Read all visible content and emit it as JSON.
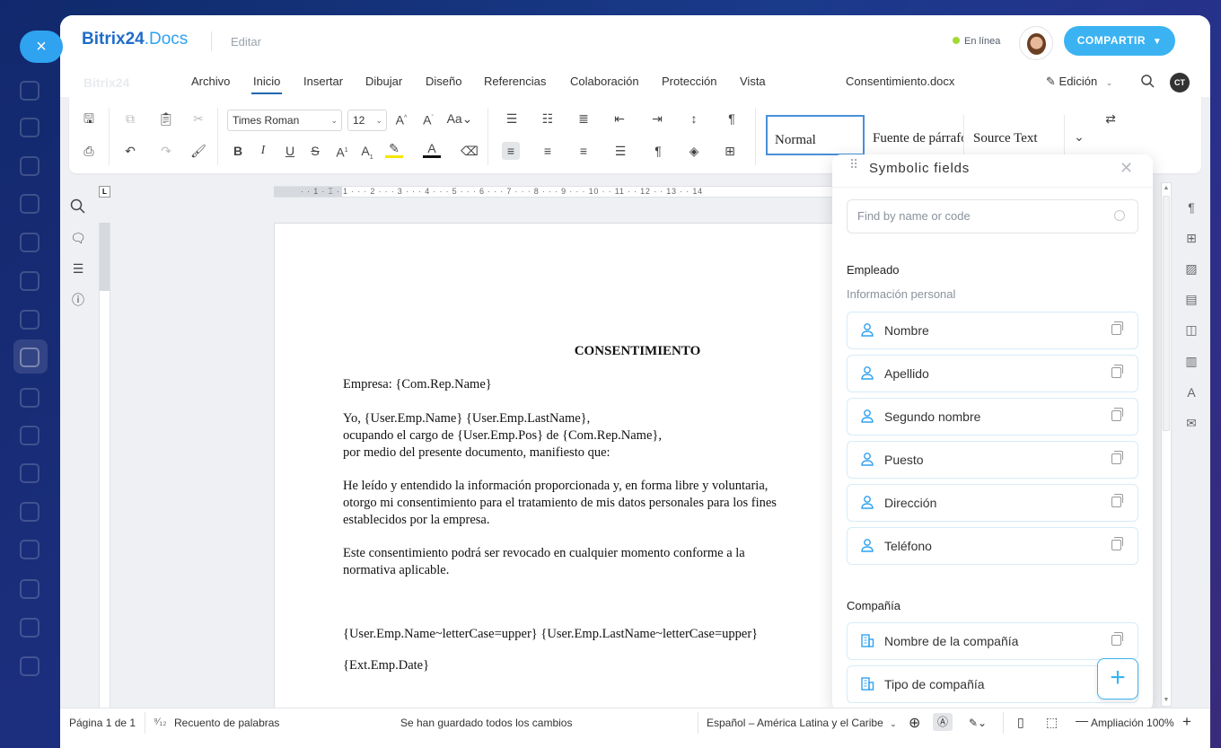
{
  "app": {
    "logo_main": "Bitrix24",
    "logo_suffix": ".Docs",
    "mode": "Editar",
    "status_online": "En línea",
    "share_label": "COMPARTIR",
    "close_symbol": "×"
  },
  "menu": {
    "ghost_logo": "Bitrix24",
    "items": [
      "Archivo",
      "Inicio",
      "Insertar",
      "Dibujar",
      "Diseño",
      "Referencias",
      "Colaboración",
      "Protección",
      "Vista"
    ],
    "active": "Inicio",
    "document_name": "Consentimiento.docx",
    "edit_mode": "Edición",
    "user_initials": "CT"
  },
  "toolbar": {
    "font_name": "Times Roman",
    "font_size": "12",
    "styles": [
      "Normal",
      "Fuente de párrafo",
      "Source Text"
    ],
    "selected_style": "Normal"
  },
  "ruler": {
    "corner_label": "L",
    "h_numbers": "· · 1 · ⌶ · 1 · · · 2 · · · 3 · · · 4 · · · 5 · · · 6 · · · 7 · · · 8 · · · 9 · · · 10 · · 11 · · 12 · · 13 · · 14"
  },
  "document": {
    "title": "CONSENTIMIENTO",
    "lines": [
      "Empresa: {Com.Rep.Name}",
      "Yo, {User.Emp.Name} {User.Emp.LastName},",
      "ocupando el cargo de {User.Emp.Pos} de {Com.Rep.Name},",
      "por medio del presente documento, manifiesto que:",
      "He leído y entendido la información proporcionada y, en forma libre y voluntaria,",
      "otorgo mi consentimiento para el tratamiento de mis datos personales para los fines",
      "establecidos por la empresa.",
      "Este consentimiento podrá ser revocado en cualquier momento conforme a la",
      "normativa aplicable.",
      "{User.Emp.Name~letterCase=upper} {User.Emp.LastName~letterCase=upper}",
      "{Ext.Emp.Date}"
    ]
  },
  "panel": {
    "title": "Symbolic fields",
    "search_placeholder": "Find by name or code",
    "sections": [
      {
        "title": "Empleado",
        "subtitle": "Información personal",
        "icon": "person-icon",
        "fields": [
          "Nombre",
          "Apellido",
          "Segundo nombre",
          "Puesto",
          "Dirección",
          "Teléfono"
        ]
      },
      {
        "title": "Compañía",
        "icon": "building-icon",
        "fields": [
          "Nombre de la compañía",
          "Tipo de compañía"
        ]
      }
    ],
    "add_symbol": "+"
  },
  "status": {
    "page": "Página 1 de 1",
    "word_count": "Recuento de palabras",
    "saved": "Se han guardado todos los cambios",
    "language": "Español – América Latina y el Caribe",
    "zoom": "Ampliación 100%"
  },
  "colors": {
    "accent": "#3bb3f2",
    "brand": "#1f6cc9",
    "online": "#a3d934",
    "field_border": "#d6ecf8",
    "field_icon": "#2fa2f0"
  }
}
